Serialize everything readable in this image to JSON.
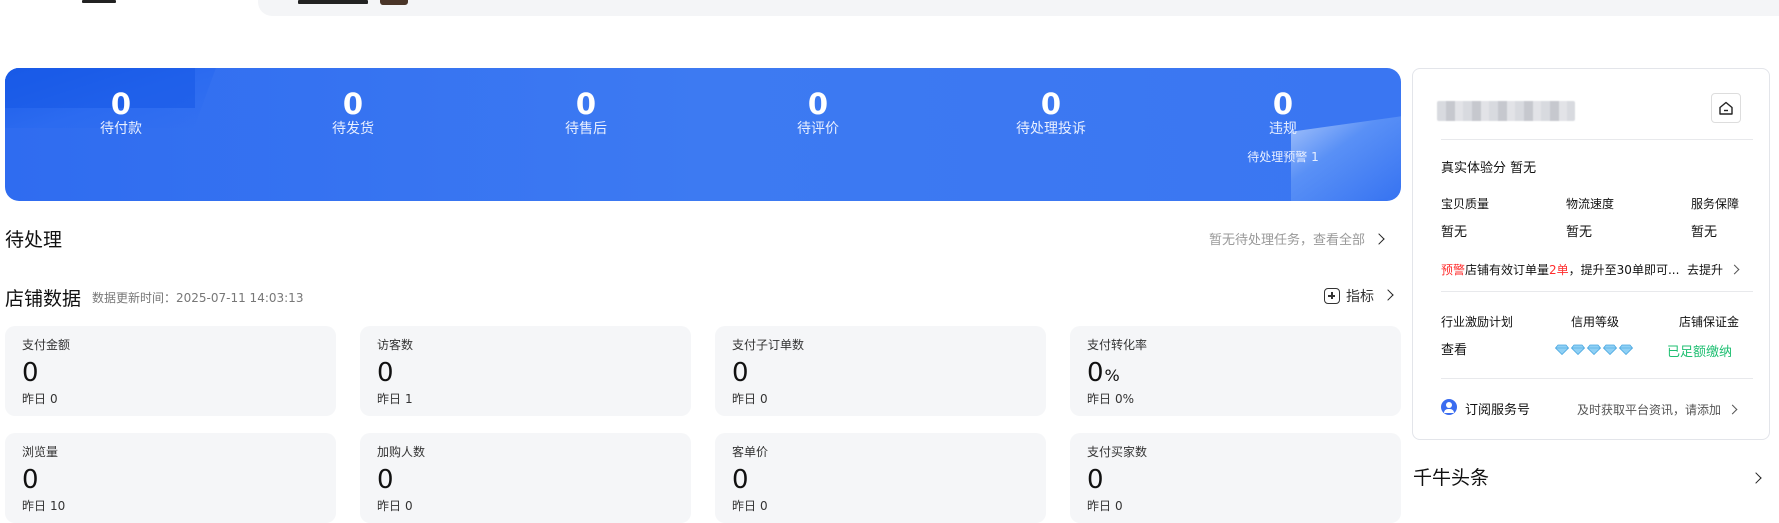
{
  "order_stats": [
    {
      "value": "0",
      "label": "待付款"
    },
    {
      "value": "0",
      "label": "待发货"
    },
    {
      "value": "0",
      "label": "待售后"
    },
    {
      "value": "0",
      "label": "待评价"
    },
    {
      "value": "0",
      "label": "待处理投诉"
    },
    {
      "value": "0",
      "label": "违规",
      "sub": "待处理预警 1"
    }
  ],
  "pending": {
    "title": "待处理",
    "link": "暂无待处理任务，查看全部"
  },
  "store_data": {
    "title": "店铺数据",
    "update_time": "数据更新时间：2025-07-11 14:03:13",
    "metrics_link": "指标",
    "cards": [
      {
        "label": "支付金额",
        "value": "0",
        "yesterday_label": "昨日",
        "yesterday": "0"
      },
      {
        "label": "访客数",
        "value": "0",
        "yesterday_label": "昨日",
        "yesterday": "1"
      },
      {
        "label": "支付子订单数",
        "value": "0",
        "yesterday_label": "昨日",
        "yesterday": "0"
      },
      {
        "label": "支付转化率",
        "value": "0",
        "unit": "%",
        "yesterday_label": "昨日",
        "yesterday": "0%"
      },
      {
        "label": "浏览量",
        "value": "0",
        "yesterday_label": "昨日",
        "yesterday": "10"
      },
      {
        "label": "加购人数",
        "value": "0",
        "yesterday_label": "昨日",
        "yesterday": "0"
      },
      {
        "label": "客单价",
        "value": "0",
        "yesterday_label": "昨日",
        "yesterday": "0"
      },
      {
        "label": "支付买家数",
        "value": "0",
        "yesterday_label": "昨日",
        "yesterday": "0"
      }
    ]
  },
  "shop_panel": {
    "experience_label": "真实体验分",
    "experience_value": "暂无",
    "scores": [
      {
        "label": "宝贝质量",
        "value": "暂无"
      },
      {
        "label": "物流速度",
        "value": "暂无"
      },
      {
        "label": "服务保障",
        "value": "暂无"
      }
    ],
    "warning_tag": "预警",
    "warning_text_1": "店铺有效订单量",
    "warning_count": "2单",
    "warning_text_2": "，提升至30单即可...",
    "warning_action": "去提升",
    "incentive_label": "行业激励计划",
    "incentive_value": "查看",
    "credit_label": "信用等级",
    "deposit_label": "店铺保证金",
    "deposit_value": "已足额缴纳",
    "subscribe_label": "订阅服务号",
    "subscribe_hint": "及时获取平台资讯，请添加"
  },
  "news": {
    "title": "千牛头条"
  },
  "colors": {
    "banner_blue": "#3d7af2",
    "warning_red": "#ff2d2d",
    "success_green": "#1fbf72"
  }
}
